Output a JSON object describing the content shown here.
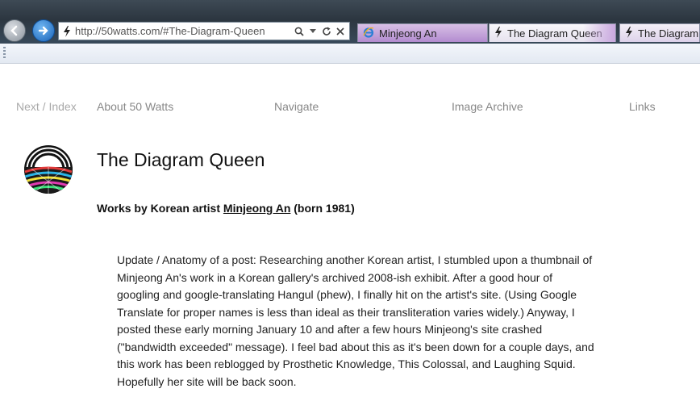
{
  "browser": {
    "address_url": "http://50watts.com/#The-Diagram-Queen",
    "tabs": [
      {
        "label": "Minjeong An",
        "icon": "ie-icon"
      },
      {
        "label": "The Diagram Queen",
        "icon": "bolt-icon"
      },
      {
        "label": "The Diagram Queen",
        "icon": "bolt-icon"
      }
    ]
  },
  "nav": {
    "next_index": "Next / Index",
    "about": "About 50 Watts",
    "navigate": "Navigate",
    "image_archive": "Image Archive",
    "links": "Links"
  },
  "post": {
    "title": "The Diagram Queen",
    "subtitle_prefix": "Works by Korean artist ",
    "artist_link": "Minjeong An",
    "subtitle_suffix": " (born 1981)",
    "body": "Update / Anatomy of a post: Researching another Korean artist, I stumbled upon a thumbnail of Minjeong An's work in a Korean gallery's archived 2008-ish exhibit. After a good hour of googling and google-translating Hangul (phew), I finally hit on the artist's site. (Using Google Translate for proper names is less than ideal as their transliteration varies widely.) Anyway, I posted these early morning January 10 and after a few hours Minjeong's site crashed (\"bandwidth exceeded\" message). I feel bad about this as it's been down for a couple days, and this work has been reblogged by Prosthetic Knowledge, This Colossal, and Laughing Squid. Hopefully her site will be back soon."
  },
  "colors": {
    "nav_text": "#888888",
    "title_text": "#111111",
    "body_text": "#222222"
  }
}
